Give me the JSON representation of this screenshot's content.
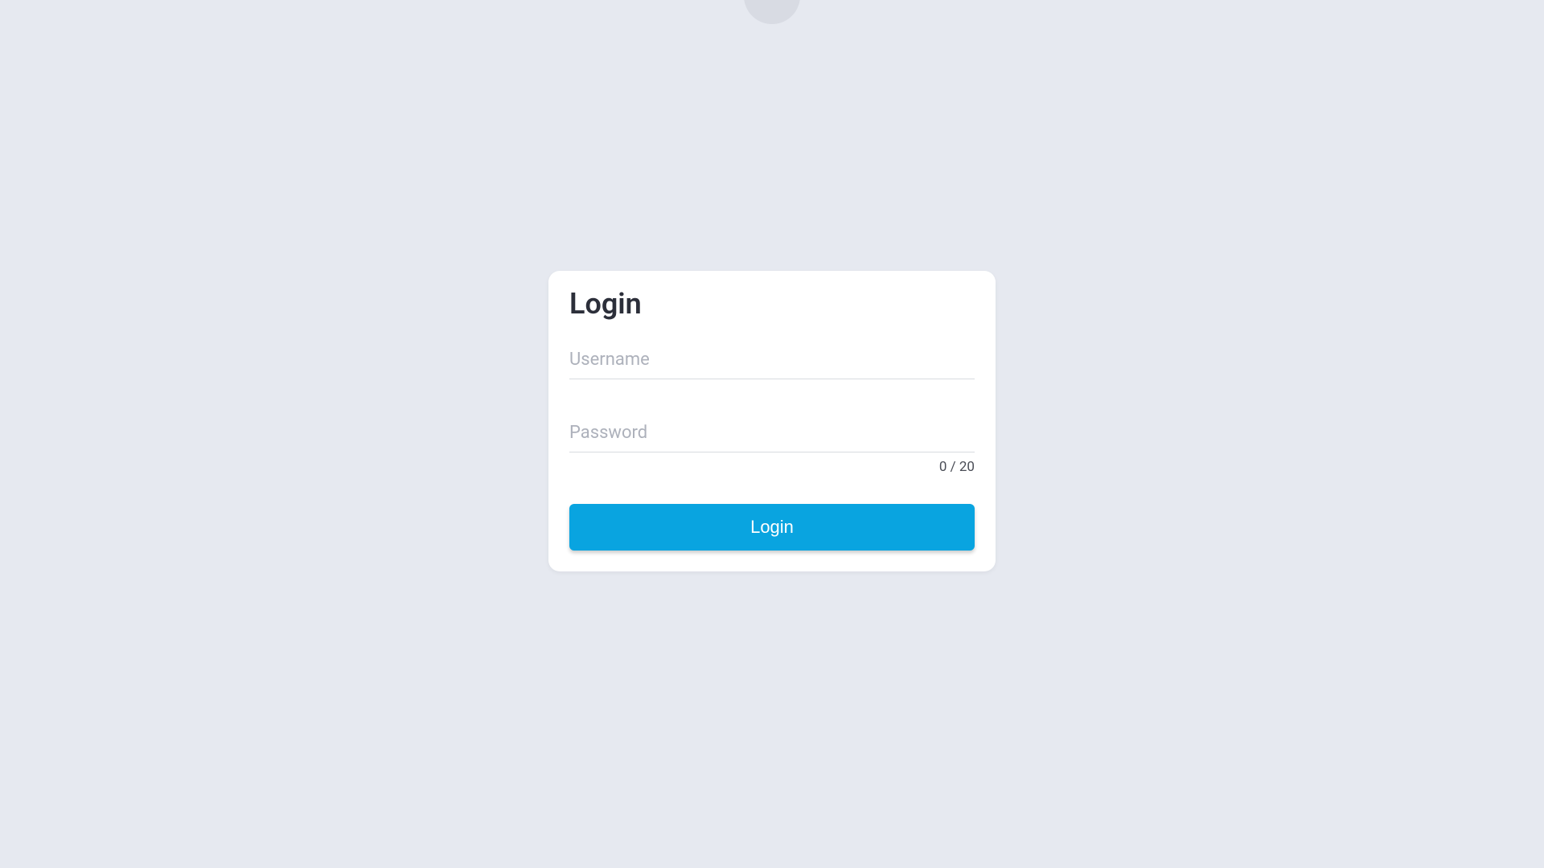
{
  "login": {
    "title": "Login",
    "username": {
      "label": "Username",
      "value": ""
    },
    "password": {
      "label": "Password",
      "value": "",
      "counter": "0 / 20"
    },
    "button_label": "Login"
  }
}
